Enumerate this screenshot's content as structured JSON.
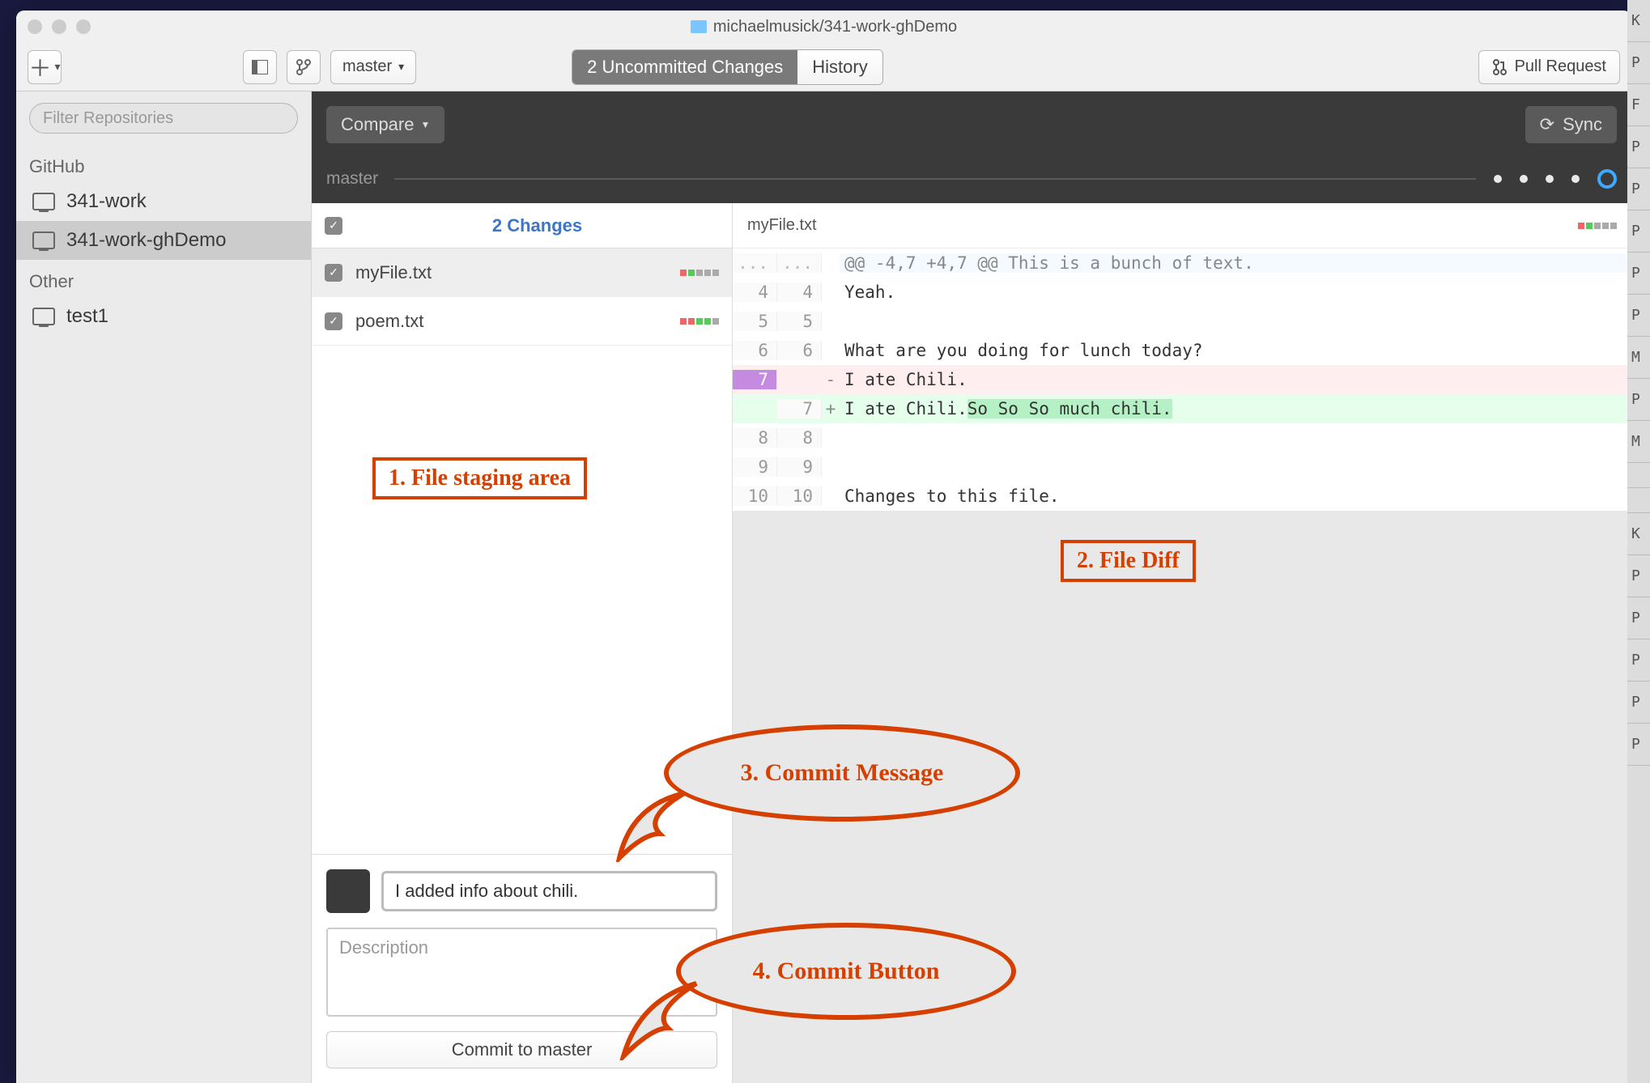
{
  "window_title": "michaelmusick/341-work-ghDemo",
  "toolbar": {
    "branch": "master",
    "tabs": {
      "changes": "2 Uncommitted Changes",
      "history": "History"
    },
    "pull_request": "Pull Request"
  },
  "sidebar": {
    "filter_placeholder": "Filter Repositories",
    "groups": [
      {
        "label": "GitHub",
        "items": [
          "341-work",
          "341-work-ghDemo"
        ],
        "selected": 1
      },
      {
        "label": "Other",
        "items": [
          "test1"
        ],
        "selected": -1
      }
    ]
  },
  "compare": {
    "button": "Compare",
    "sync": "Sync",
    "branch": "master"
  },
  "changes": {
    "title": "2 Changes",
    "files": [
      {
        "name": "myFile.txt",
        "selected": true
      },
      {
        "name": "poem.txt",
        "selected": false
      }
    ]
  },
  "diff": {
    "filename": "myFile.txt",
    "hunk_header": "@@ -4,7 +4,7 @@ This is a bunch of text.",
    "lines": [
      {
        "old": "4",
        "new": "4",
        "t": "ctx",
        "m": " ",
        "text": "Yeah."
      },
      {
        "old": "5",
        "new": "5",
        "t": "ctx",
        "m": " ",
        "text": ""
      },
      {
        "old": "6",
        "new": "6",
        "t": "ctx",
        "m": " ",
        "text": "What are you doing for lunch today?"
      },
      {
        "old": "7",
        "new": "",
        "t": "del",
        "m": "-",
        "text": "I ate Chili."
      },
      {
        "old": "",
        "new": "7",
        "t": "add",
        "m": "+",
        "text": "I ate Chili.",
        "added_suffix": "So So So much chili."
      },
      {
        "old": "8",
        "new": "8",
        "t": "ctx",
        "m": " ",
        "text": ""
      },
      {
        "old": "9",
        "new": "9",
        "t": "ctx",
        "m": " ",
        "text": ""
      },
      {
        "old": "10",
        "new": "10",
        "t": "ctx",
        "m": " ",
        "text": "Changes to this file."
      }
    ]
  },
  "commit": {
    "summary_value": "I added info about chili.",
    "description_placeholder": "Description",
    "button": "Commit to master"
  },
  "annots": {
    "a1": "1. File staging area",
    "a2": "2. File Diff",
    "a3": "3. Commit Message",
    "a4": "4. Commit Button"
  },
  "letters_col": [
    "K",
    "P",
    "F",
    "P",
    "P",
    "P",
    "P",
    "P",
    "M",
    "P",
    "M",
    "",
    "",
    "K",
    "P",
    "P",
    "P",
    "P",
    "P"
  ]
}
